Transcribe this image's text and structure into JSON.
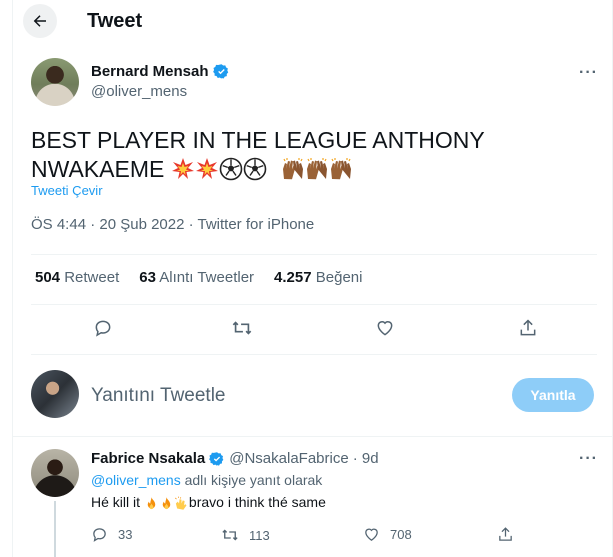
{
  "header": {
    "title": "Tweet"
  },
  "tweet": {
    "author_name": "Bernard Mensah",
    "author_handle": "@oliver_mens",
    "text_line1": "BEST PLAYER IN THE LEAGUE  ANTHONY",
    "text_line2": "NWAKAEME ",
    "emojis": [
      "collision",
      "collision",
      "soccer-ball",
      "soccer-ball",
      "raised-hands",
      "raised-hands",
      "raised-hands"
    ],
    "translate_label": "Tweeti Çevir",
    "meta": "ÖS 4:44 · 20 Şub 2022 · Twitter for iPhone",
    "stats": {
      "retweets_count": "504",
      "retweets_label": "Retweet",
      "quotes_count": "63",
      "quotes_label": "Alıntı Tweetler",
      "likes_count": "4.257",
      "likes_label": "Beğeni"
    }
  },
  "reply_box": {
    "placeholder": "Yanıtını Tweetle",
    "button_label": "Yanıtla"
  },
  "reply": {
    "name": "Fabrice Nsakala",
    "handle": "@NsakalaFabrice",
    "time": "· 9d",
    "replying_handle": "@oliver_mens",
    "replying_suffix": " adlı kişiye yanıt olarak",
    "text_start": "Hé kill it ",
    "text_end": "bravo i think thé  same",
    "reply_count": "33",
    "retweet_count": "113",
    "like_count": "708"
  },
  "colors": {
    "accent": "#1d9bf0",
    "secondary_text": "#536471",
    "button_disabled": "#8ecdf8",
    "border": "#eff3f4"
  }
}
